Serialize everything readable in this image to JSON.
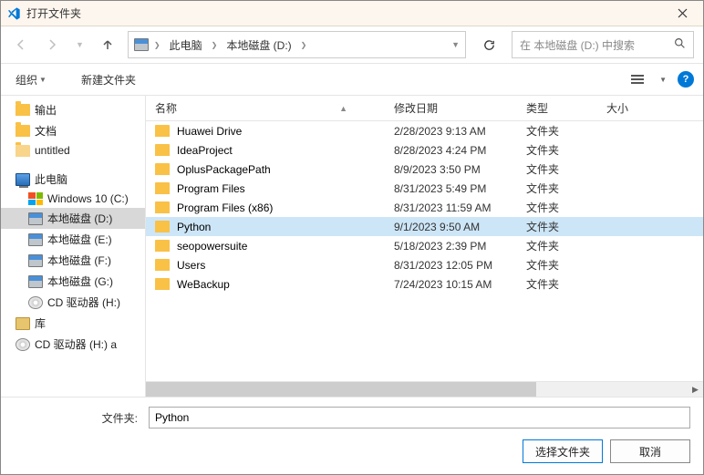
{
  "title": "打开文件夹",
  "breadcrumb": {
    "root": "此电脑",
    "drive": "本地磁盘 (D:)"
  },
  "search": {
    "placeholder": "在 本地磁盘 (D:) 中搜索"
  },
  "toolbar": {
    "organize": "组织",
    "newfolder": "新建文件夹"
  },
  "columns": {
    "name": "名称",
    "date": "修改日期",
    "type": "类型",
    "size": "大小"
  },
  "tree": {
    "quick": [
      {
        "label": "输出"
      },
      {
        "label": "文档"
      },
      {
        "label": "untitled",
        "open": true
      }
    ],
    "pc_label": "此电脑",
    "drives": [
      {
        "label": "Windows 10 (C:)",
        "icon": "win"
      },
      {
        "label": "本地磁盘 (D:)",
        "icon": "disk",
        "selected": true
      },
      {
        "label": "本地磁盘 (E:)",
        "icon": "disk"
      },
      {
        "label": "本地磁盘 (F:)",
        "icon": "disk"
      },
      {
        "label": "本地磁盘 (G:)",
        "icon": "disk"
      },
      {
        "label": "CD 驱动器 (H:)",
        "icon": "cd"
      }
    ],
    "lib_label": "库",
    "extra": [
      {
        "label": "CD 驱动器 (H:) a",
        "icon": "cd"
      }
    ]
  },
  "files": [
    {
      "name": "Huawei Drive",
      "date": "2/28/2023 9:13 AM",
      "type": "文件夹"
    },
    {
      "name": "IdeaProject",
      "date": "8/28/2023 4:24 PM",
      "type": "文件夹"
    },
    {
      "name": "OplusPackagePath",
      "date": "8/9/2023 3:50 PM",
      "type": "文件夹"
    },
    {
      "name": "Program Files",
      "date": "8/31/2023 5:49 PM",
      "type": "文件夹"
    },
    {
      "name": "Program Files (x86)",
      "date": "8/31/2023 11:59 AM",
      "type": "文件夹"
    },
    {
      "name": "Python",
      "date": "9/1/2023 9:50 AM",
      "type": "文件夹",
      "selected": true
    },
    {
      "name": "seopowersuite",
      "date": "5/18/2023 2:39 PM",
      "type": "文件夹"
    },
    {
      "name": "Users",
      "date": "8/31/2023 12:05 PM",
      "type": "文件夹"
    },
    {
      "name": "WeBackup",
      "date": "7/24/2023 10:15 AM",
      "type": "文件夹"
    }
  ],
  "footer": {
    "folder_label": "文件夹:",
    "folder_value": "Python",
    "select": "选择文件夹",
    "cancel": "取消"
  }
}
